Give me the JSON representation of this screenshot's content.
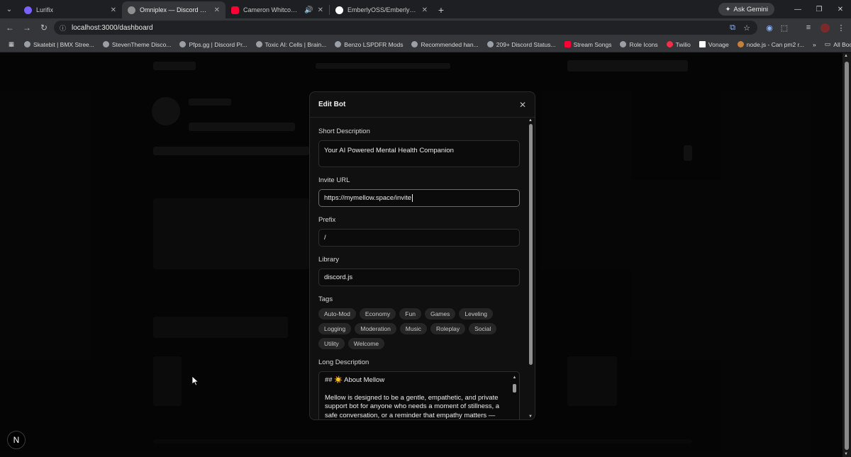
{
  "browser": {
    "tabs": [
      {
        "label": "Lurifix",
        "color": "#7b61ff",
        "active": false
      },
      {
        "label": "Omniplex — Discord Bot List",
        "color": "#8f8f8f",
        "active": true
      },
      {
        "label": "Cameron Whitcomb - Hund",
        "color": "#ff0033",
        "active": false
      },
      {
        "label": "EmberlyOSS/Emberly: Emberly",
        "color": "#ffffff",
        "active": false
      }
    ],
    "ask_gemini": "Ask Gemini",
    "url": "localhost:3000/dashboard",
    "bookmarks": [
      "Skatebit | BMX Stree...",
      "StevenTheme Disco...",
      "Pfps.gg | Discord Pr...",
      "Toxic AI: Cells | Brain...",
      "Benzo LSPDFR Mods",
      "Recommended han...",
      "209+ Discord Status...",
      "Stream Songs",
      "Role Icons",
      "Twilio",
      "Vonage",
      "node.js - Can pm2 r..."
    ],
    "all_bookmarks": "All Bookmarks"
  },
  "modal": {
    "title": "Edit Bot",
    "short_description": {
      "label": "Short Description",
      "value": "Your AI Powered Mental Health Companion"
    },
    "invite_url": {
      "label": "Invite URL",
      "value": "https://mymellow.space/invite"
    },
    "prefix": {
      "label": "Prefix",
      "value": "/"
    },
    "library": {
      "label": "Library",
      "value": "discord.js"
    },
    "tags_label": "Tags",
    "tags": [
      "Auto-Mod",
      "Economy",
      "Fun",
      "Games",
      "Leveling",
      "Logging",
      "Moderation",
      "Music",
      "Roleplay",
      "Social",
      "Utility",
      "Welcome"
    ],
    "long_description": {
      "label": "Long Description",
      "heading": "## ☀️ About Mellow",
      "body": "Mellow is designed to be a gentle, empathetic, and private support bot for anyone who needs a moment of stillness, a safe conversation, or a reminder that empathy matters — even online. Built with privacy and safety at its core, Mellow provides 24/7 mental health support directly within Discord communities."
    }
  },
  "corner_badge": "N"
}
